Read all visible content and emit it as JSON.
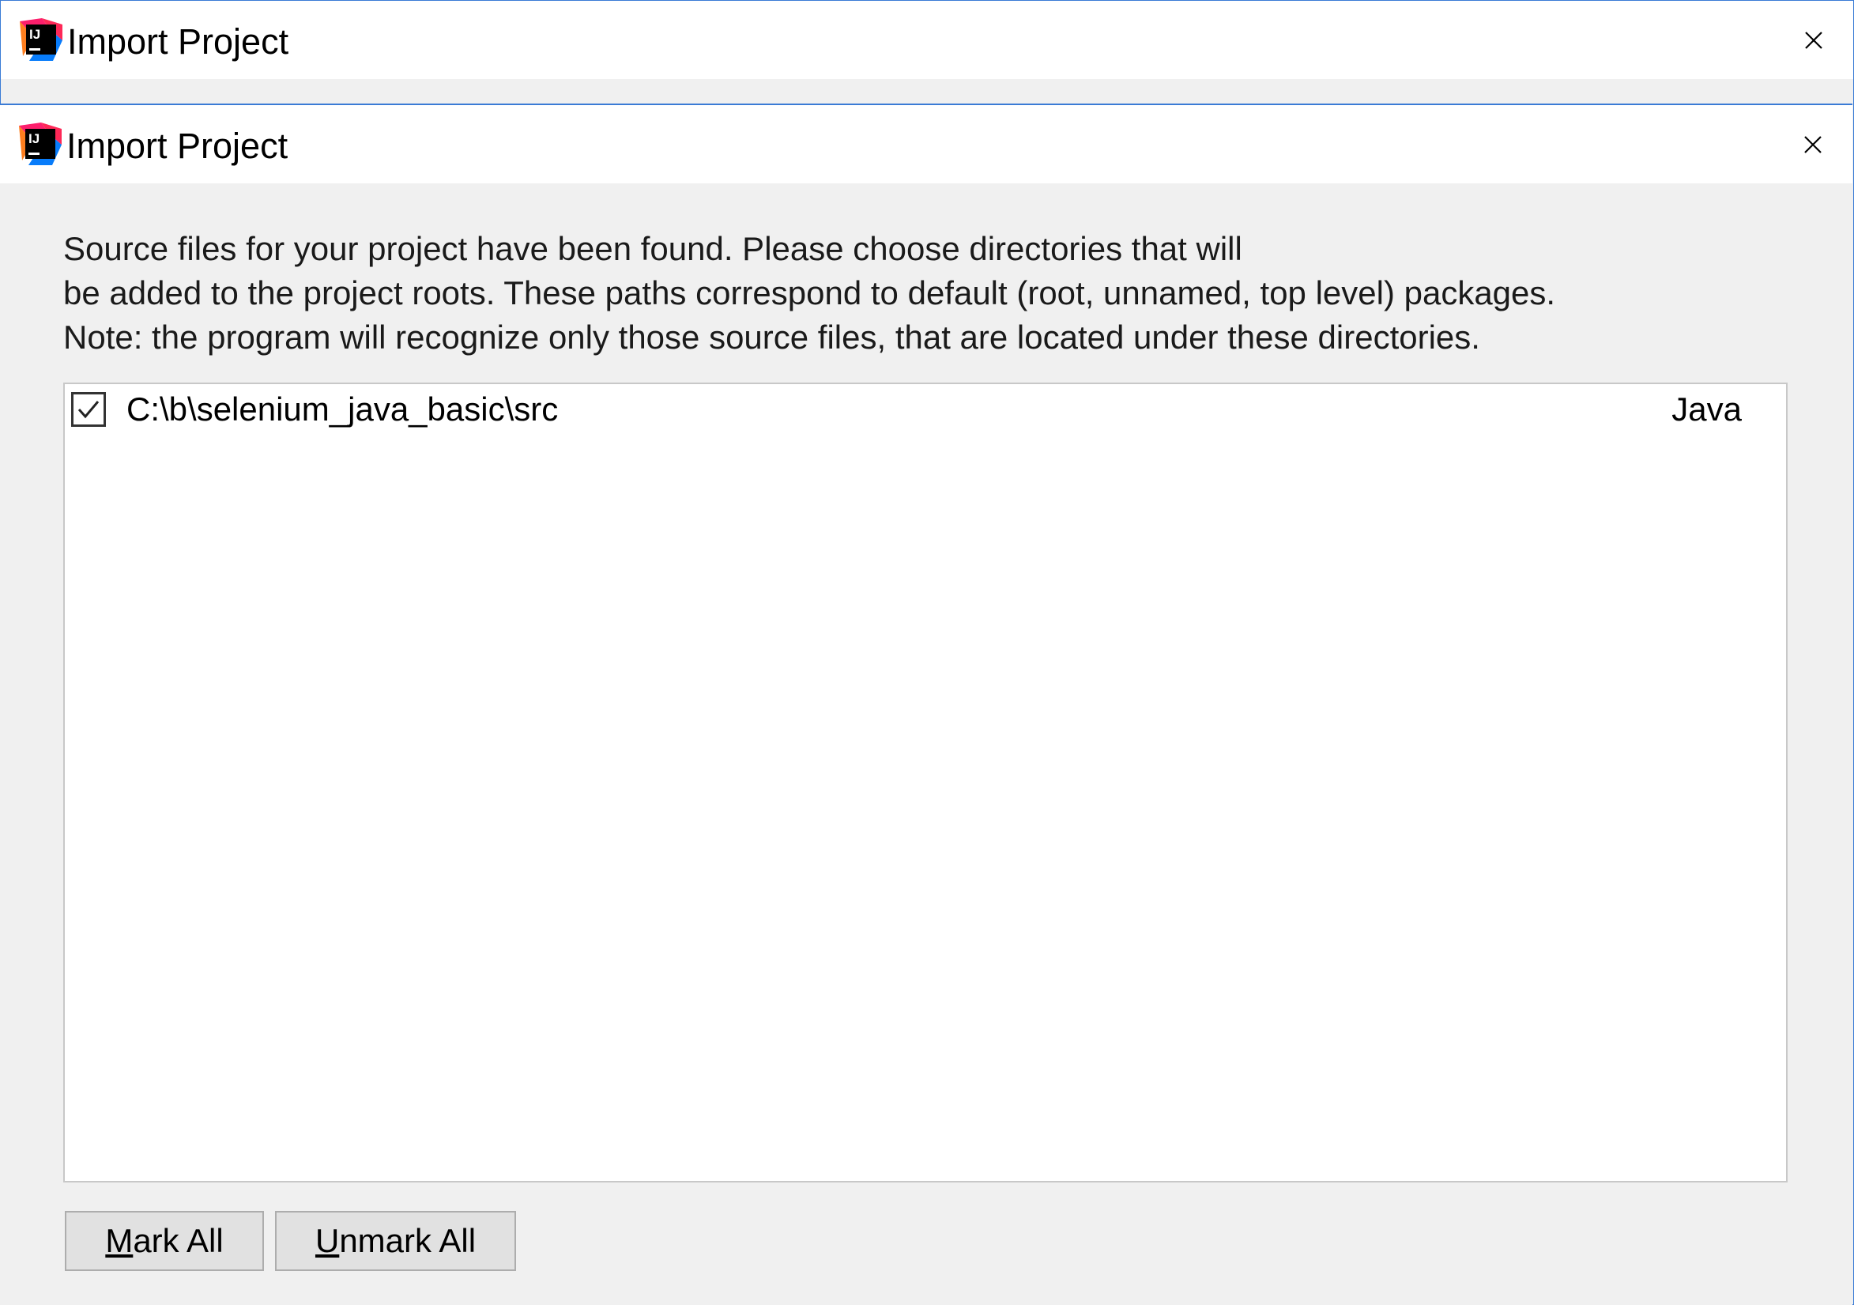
{
  "outer_window": {
    "title": "Import Project",
    "close_symbol": "×"
  },
  "dialog": {
    "title": "Import Project",
    "close_symbol": "×",
    "description": [
      "Source files for your project have been found. Please choose directories that will",
      "be added to the project roots. These paths correspond to default (root, unnamed, top level) packages.",
      "Note: the program will recognize only those source files, that are located under these directories."
    ],
    "roots": [
      {
        "checked": true,
        "path": "C:\\b\\selenium_java_basic\\src",
        "type": "Java"
      }
    ],
    "buttons": {
      "mark_all": {
        "mnemonic": "M",
        "rest": "ark All"
      },
      "unmark_all": {
        "mnemonic": "U",
        "rest": "nmark All"
      }
    }
  },
  "icons": {
    "app": "intellij-idea-icon",
    "close": "close-icon",
    "check": "checkmark-icon"
  },
  "colors": {
    "window_border": "#3a7bd5",
    "background": "#f0f0f0",
    "titlebar": "#ffffff"
  }
}
